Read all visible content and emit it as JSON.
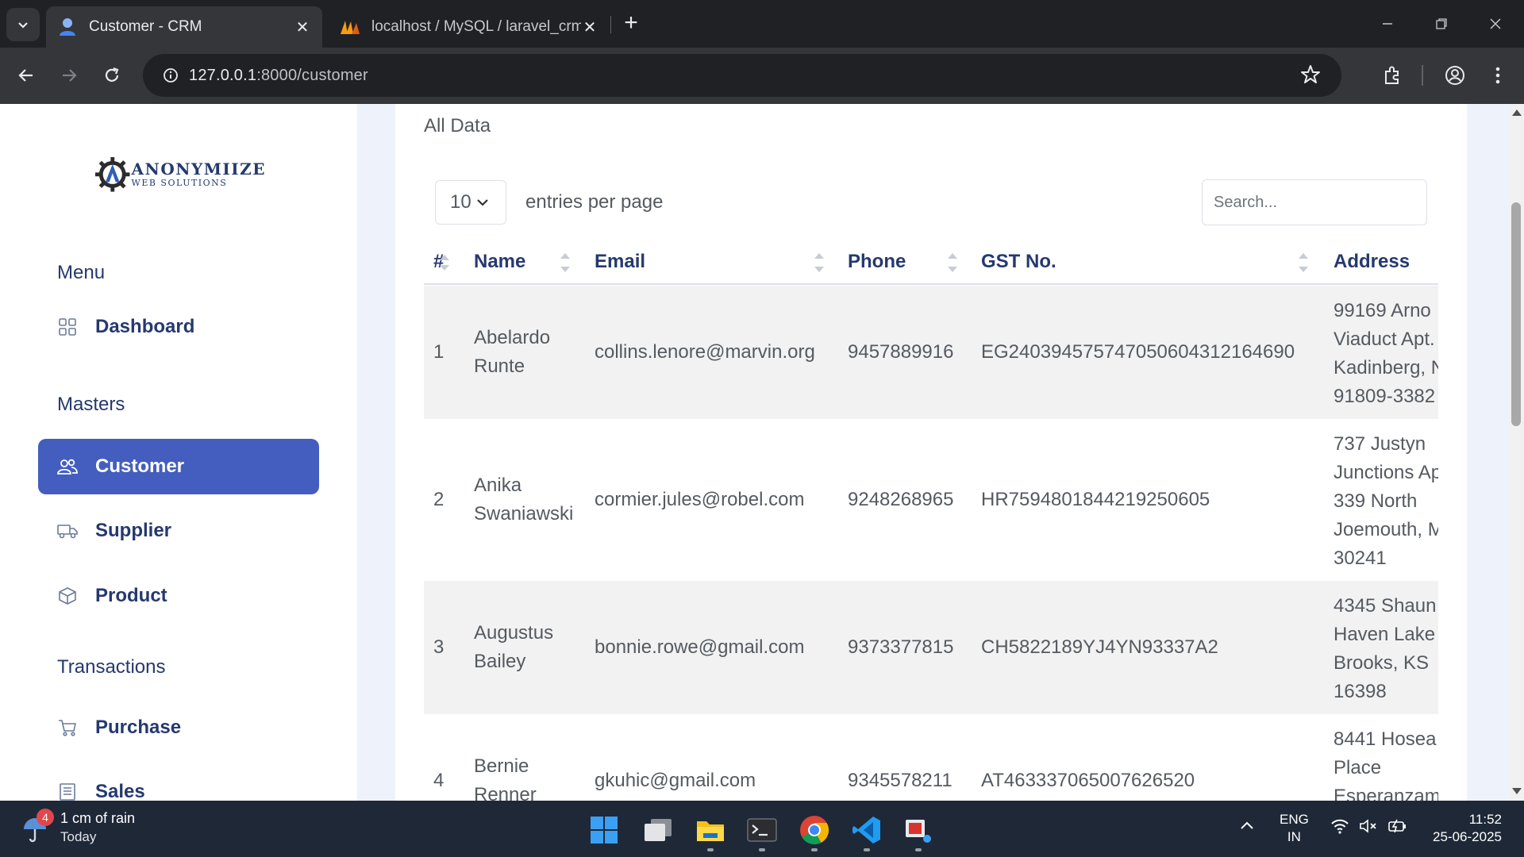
{
  "browser": {
    "tabs": [
      {
        "title": "Customer - CRM",
        "active": true
      },
      {
        "title": "localhost / MySQL / laravel_crm",
        "active": false
      }
    ],
    "url_host": "127.0.0.1",
    "url_path": ":8000/customer"
  },
  "sidebar": {
    "logo_main": "ANONYMIIZE",
    "logo_sub": "WEB SOLUTIONS",
    "sections": {
      "menu": "Menu",
      "masters": "Masters",
      "transactions": "Transactions"
    },
    "items": [
      {
        "label": "Dashboard",
        "icon": "grid-icon",
        "active": false
      },
      {
        "label": "Customer",
        "icon": "people-icon",
        "active": true
      },
      {
        "label": "Supplier",
        "icon": "truck-icon",
        "active": false
      },
      {
        "label": "Product",
        "icon": "box-icon",
        "active": false
      },
      {
        "label": "Purchase",
        "icon": "cart-icon",
        "active": false
      },
      {
        "label": "Sales",
        "icon": "receipt-icon",
        "active": false
      }
    ],
    "accent_color": "#435ebe"
  },
  "main": {
    "title": "All Data",
    "per_page_value": "10",
    "per_page_label": "entries per page",
    "search_placeholder": "Search...",
    "table": {
      "columns": [
        "#",
        "Name",
        "Email",
        "Phone",
        "GST No.",
        "Address"
      ],
      "rows": [
        {
          "num": "1",
          "name_first": "Abelardo",
          "name_last": "Runte",
          "email": "collins.lenore@marvin.org",
          "phone": "9457889916",
          "gst": "EG2403945757470506043121646​90",
          "address": [
            "99169 Arno",
            "Viaduct Apt.",
            "Kadinberg, N",
            "91809-3382"
          ]
        },
        {
          "num": "2",
          "name_first": "Anika",
          "name_last": "Swaniawski",
          "email": "cormier.jules@robel.com",
          "phone": "9248268965",
          "gst": "HR7594801844219250605",
          "address": [
            "737 Justyn",
            "Junctions Ap",
            "339 North",
            "Joemouth, M",
            "30241"
          ]
        },
        {
          "num": "3",
          "name_first": "Augustus",
          "name_last": "Bailey",
          "email": "bonnie.rowe@gmail.com",
          "phone": "9373377815",
          "gst": "CH5822189YJ4YN93337A2",
          "address": [
            "4345 Shaun",
            "Haven Lake",
            "Brooks, KS",
            "16398"
          ]
        },
        {
          "num": "4",
          "name_first": "Bernie",
          "name_last": "Renner",
          "email": "gkuhic@gmail.com",
          "phone": "9345578211",
          "gst": "AT463337065007626520",
          "address": [
            "8441 Hosea",
            "Place",
            "Esperanzam"
          ]
        }
      ]
    }
  },
  "taskbar": {
    "weather_badge": "4",
    "weather_main": "1 cm of rain",
    "weather_sub": "Today",
    "lang_1": "ENG",
    "lang_2": "IN",
    "time": "11:52",
    "date": "25-06-2025"
  }
}
